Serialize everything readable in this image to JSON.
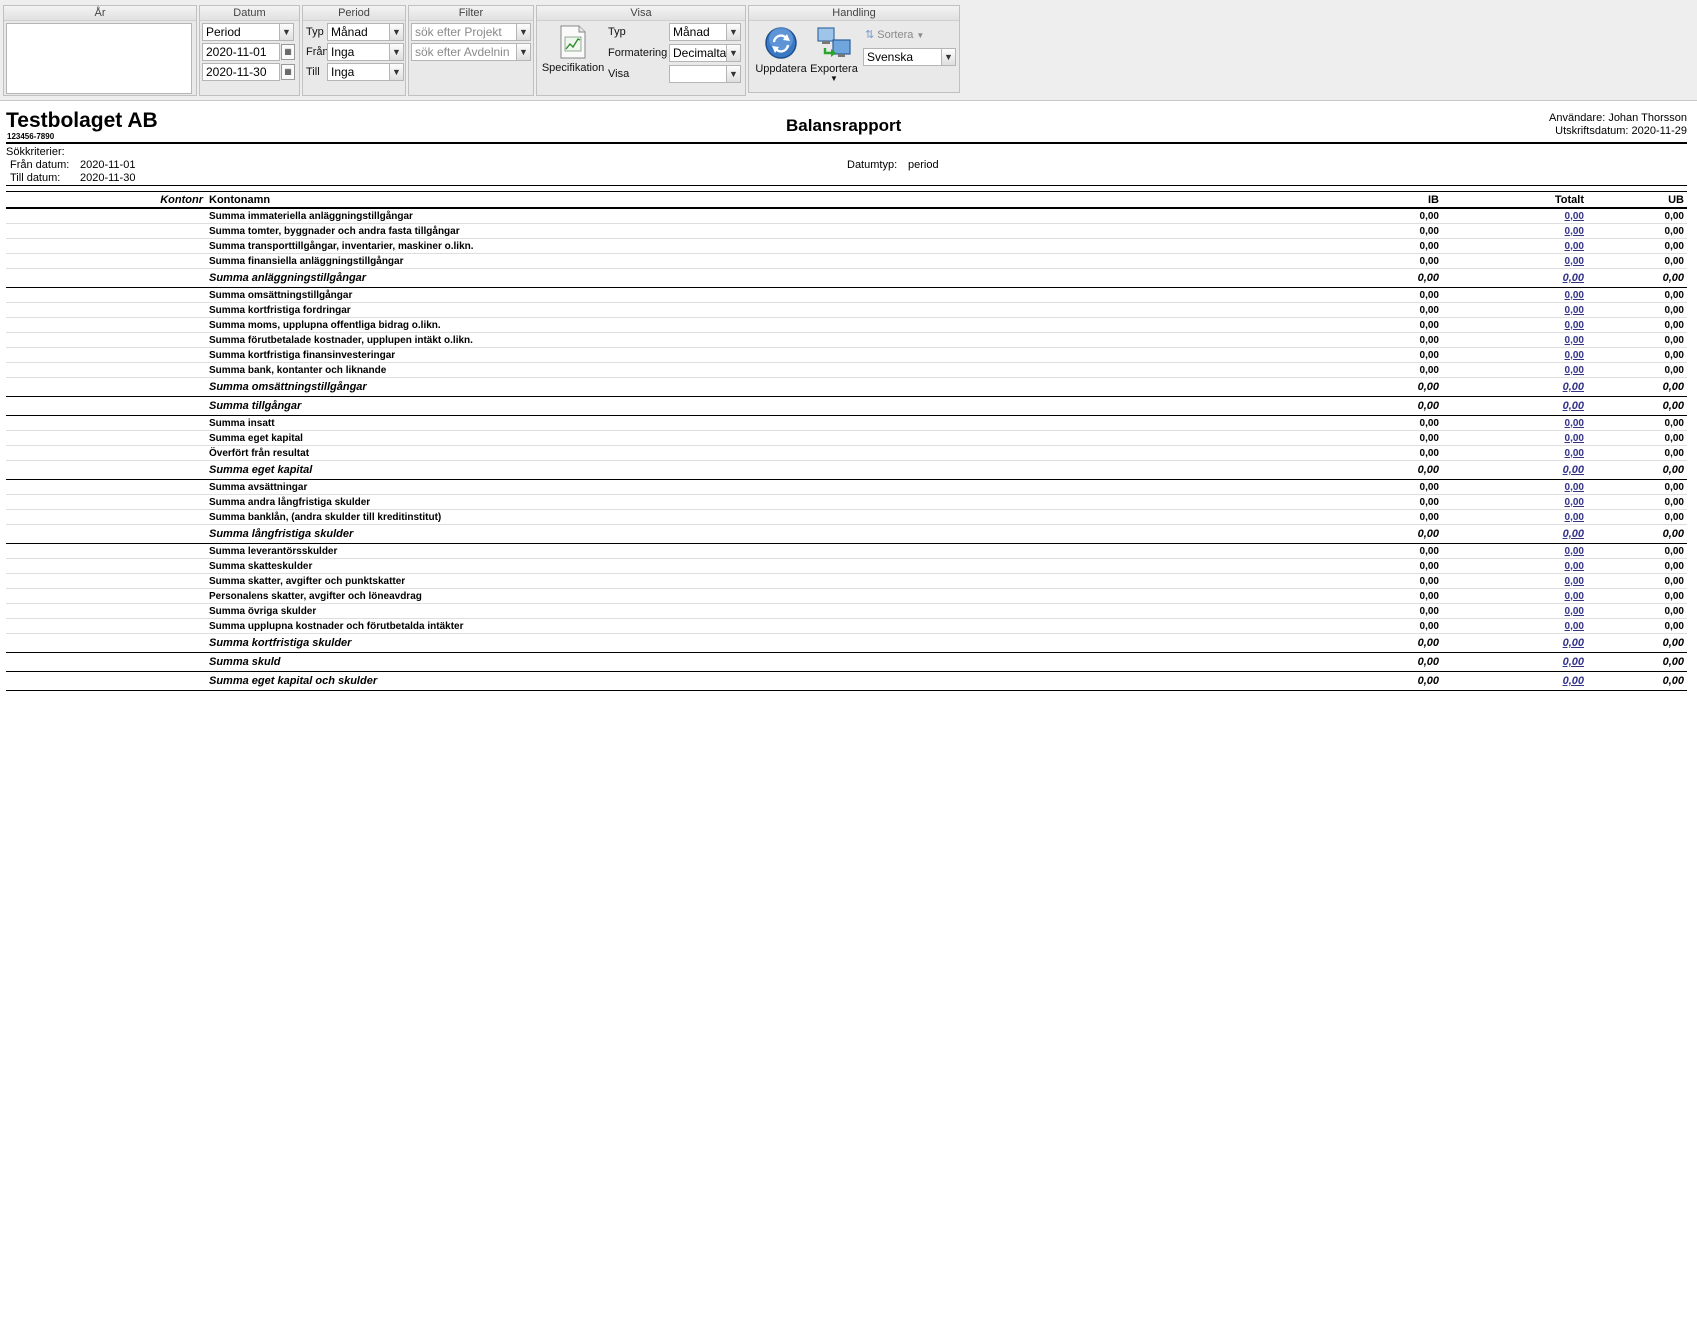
{
  "toolbar": {
    "ar": {
      "title": "År"
    },
    "datum": {
      "title": "Datum",
      "type_value": "Period",
      "from_value": "2020-11-01",
      "to_value": "2020-11-30"
    },
    "period": {
      "title": "Period",
      "typ_label": "Typ",
      "typ_value": "Månad",
      "fran_label": "Från",
      "fran_value": "Inga",
      "till_label": "Till",
      "till_value": "Inga"
    },
    "filter": {
      "title": "Filter",
      "project_placeholder": "sök efter Projekt",
      "avdelning_placeholder": "sök efter Avdelnin"
    },
    "visa": {
      "title": "Visa",
      "spec_label": "Specifikation",
      "typ_label": "Typ",
      "typ_value": "Månad",
      "format_label": "Formatering",
      "format_value": "Decimalta",
      "visa_label": "Visa",
      "visa_value": ""
    },
    "handling": {
      "title": "Handling",
      "update_label": "Uppdatera",
      "export_label": "Exportera",
      "sort_label": "Sortera",
      "language_value": "Svenska"
    }
  },
  "report": {
    "company": "Testbolaget AB",
    "org_number": "123456-7890",
    "title": "Balansrapport",
    "user_line": "Användare: Johan Thorsson",
    "print_date_line": "Utskriftsdatum: 2020-11-29",
    "criteria_label": "Sökkriterier:",
    "from_label": "Från datum:",
    "from_value": "2020-11-01",
    "to_label": "Till datum:",
    "to_value": "2020-11-30",
    "datetype_label": "Datumtyp:",
    "datetype_value": "period",
    "columns": {
      "kontonr": "Kontonr",
      "kontonamn": "Kontonamn",
      "ib": "IB",
      "totalt": "Totalt",
      "ub": "UB"
    },
    "rows": [
      {
        "kind": "r",
        "name": "Summa immateriella anläggningstillgångar",
        "ib": "0,00",
        "totalt": "0,00",
        "ub": "0,00"
      },
      {
        "kind": "r",
        "name": "Summa tomter, byggnader och andra fasta tillgångar",
        "ib": "0,00",
        "totalt": "0,00",
        "ub": "0,00"
      },
      {
        "kind": "r",
        "name": "Summa transporttillgångar, inventarier, maskiner o.likn.",
        "ib": "0,00",
        "totalt": "0,00",
        "ub": "0,00"
      },
      {
        "kind": "r",
        "name": "Summa finansiella anläggningstillgångar",
        "ib": "0,00",
        "totalt": "0,00",
        "ub": "0,00"
      },
      {
        "kind": "s",
        "name": "Summa anläggningstillgångar",
        "ib": "0,00",
        "totalt": "0,00",
        "ub": "0,00"
      },
      {
        "kind": "r",
        "name": "Summa omsättningstillgångar",
        "ib": "0,00",
        "totalt": "0,00",
        "ub": "0,00"
      },
      {
        "kind": "r",
        "name": "Summa kortfristiga fordringar",
        "ib": "0,00",
        "totalt": "0,00",
        "ub": "0,00"
      },
      {
        "kind": "r",
        "name": "Summa moms, upplupna offentliga bidrag o.likn.",
        "ib": "0,00",
        "totalt": "0,00",
        "ub": "0,00"
      },
      {
        "kind": "r",
        "name": "Summa förutbetalade kostnader, upplupen intäkt o.likn.",
        "ib": "0,00",
        "totalt": "0,00",
        "ub": "0,00"
      },
      {
        "kind": "r",
        "name": "Summa kortfristiga finansinvesteringar",
        "ib": "0,00",
        "totalt": "0,00",
        "ub": "0,00"
      },
      {
        "kind": "r",
        "name": "Summa bank, kontanter och liknande",
        "ib": "0,00",
        "totalt": "0,00",
        "ub": "0,00"
      },
      {
        "kind": "s",
        "name": "Summa omsättningstillgångar",
        "ib": "0,00",
        "totalt": "0,00",
        "ub": "0,00"
      },
      {
        "kind": "s",
        "name": "Summa tillgångar",
        "ib": "0,00",
        "totalt": "0,00",
        "ub": "0,00"
      },
      {
        "kind": "r",
        "name": "Summa insatt",
        "ib": "0,00",
        "totalt": "0,00",
        "ub": "0,00"
      },
      {
        "kind": "r",
        "name": "Summa eget kapital",
        "ib": "0,00",
        "totalt": "0,00",
        "ub": "0,00"
      },
      {
        "kind": "r",
        "name": "Överfört från resultat",
        "ib": "0,00",
        "totalt": "0,00",
        "ub": "0,00"
      },
      {
        "kind": "s",
        "name": "Summa eget kapital",
        "ib": "0,00",
        "totalt": "0,00",
        "ub": "0,00"
      },
      {
        "kind": "r",
        "name": "Summa avsättningar",
        "ib": "0,00",
        "totalt": "0,00",
        "ub": "0,00"
      },
      {
        "kind": "r",
        "name": "Summa andra långfristiga skulder",
        "ib": "0,00",
        "totalt": "0,00",
        "ub": "0,00"
      },
      {
        "kind": "r",
        "name": "Summa banklån, (andra skulder till kreditinstitut)",
        "ib": "0,00",
        "totalt": "0,00",
        "ub": "0,00"
      },
      {
        "kind": "s",
        "name": "Summa långfristiga skulder",
        "ib": "0,00",
        "totalt": "0,00",
        "ub": "0,00"
      },
      {
        "kind": "r",
        "name": "Summa leverantörsskulder",
        "ib": "0,00",
        "totalt": "0,00",
        "ub": "0,00"
      },
      {
        "kind": "r",
        "name": "Summa skatteskulder",
        "ib": "0,00",
        "totalt": "0,00",
        "ub": "0,00"
      },
      {
        "kind": "r",
        "name": "Summa skatter, avgifter och punktskatter",
        "ib": "0,00",
        "totalt": "0,00",
        "ub": "0,00"
      },
      {
        "kind": "r",
        "name": "Personalens skatter, avgifter och löneavdrag",
        "ib": "0,00",
        "totalt": "0,00",
        "ub": "0,00"
      },
      {
        "kind": "r",
        "name": "Summa övriga skulder",
        "ib": "0,00",
        "totalt": "0,00",
        "ub": "0,00"
      },
      {
        "kind": "r",
        "name": "Summa upplupna kostnader och förutbetalda intäkter",
        "ib": "0,00",
        "totalt": "0,00",
        "ub": "0,00"
      },
      {
        "kind": "s",
        "name": "Summa kortfristiga skulder",
        "ib": "0,00",
        "totalt": "0,00",
        "ub": "0,00"
      },
      {
        "kind": "s",
        "name": "Summa skuld",
        "ib": "0,00",
        "totalt": "0,00",
        "ub": "0,00"
      },
      {
        "kind": "s",
        "name": "Summa eget kapital och skulder",
        "ib": "0,00",
        "totalt": "0,00",
        "ub": "0,00"
      }
    ]
  }
}
